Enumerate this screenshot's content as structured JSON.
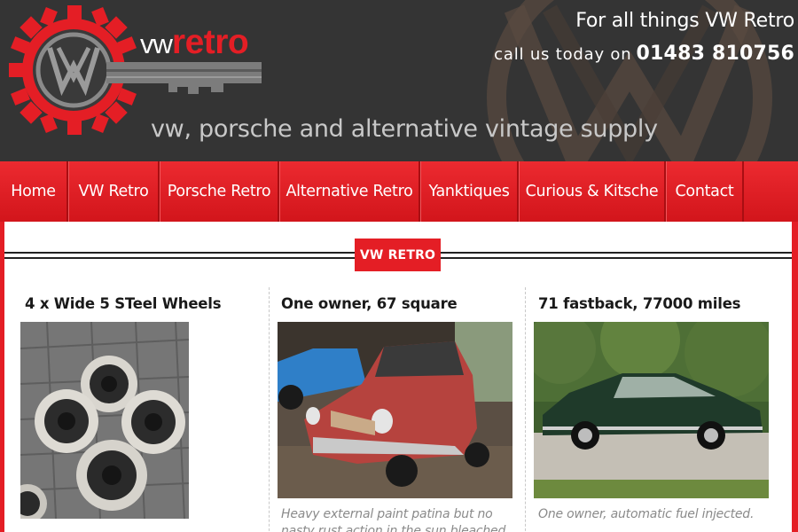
{
  "header": {
    "logo": {
      "vw": "vw",
      "retro": "retro"
    },
    "tagline": "vw, porsche and alternative vintage supply",
    "slogan": "For all things VW Retro",
    "call_text": "call us today on",
    "phone": "01483 810756"
  },
  "nav": {
    "items": [
      {
        "label": "Home"
      },
      {
        "label": "VW Retro"
      },
      {
        "label": "Porsche Retro"
      },
      {
        "label": "Alternative Retro"
      },
      {
        "label": "Yanktiques"
      },
      {
        "label": "Curious & Kitsche"
      },
      {
        "label": "Contact"
      }
    ]
  },
  "section": {
    "badge": "VW RETRO"
  },
  "products": [
    {
      "title": "4 x Wide 5 STeel Wheels",
      "image": "steel-wheels-photo",
      "description": ""
    },
    {
      "title": "One owner, 67 square",
      "image": "red-squareback-photo",
      "description": "Heavy external paint patina but no nasty rust action in the sun bleached areas"
    },
    {
      "title": "71 fastback, 77000 miles",
      "image": "green-fastback-photo",
      "description": "One owner, automatic fuel injected."
    }
  ],
  "colors": {
    "brand_red": "#e41e25",
    "header_bg": "#343434",
    "tagline_gray": "#c8c8c8"
  }
}
